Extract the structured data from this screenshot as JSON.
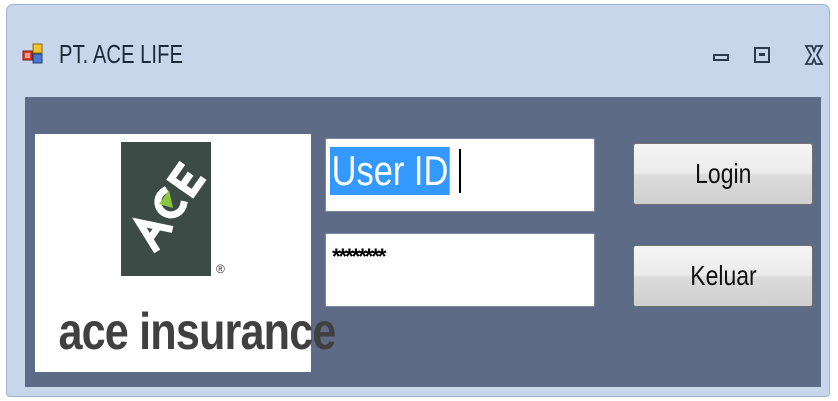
{
  "window": {
    "title": "PT. ACE LIFE",
    "controls": [
      "minimize-icon",
      "maximize-icon",
      "close-icon"
    ]
  },
  "logo": {
    "mark_text": "ACE",
    "registered": "®",
    "wordmark": "ace insurance"
  },
  "form": {
    "user_id_value": "User ID",
    "password_value": "********"
  },
  "buttons": {
    "login_label": "Login",
    "exit_label": "Keluar"
  },
  "colors": {
    "titlebar": "#c7d6ea",
    "client_bg": "#5d6b86",
    "selection": "#3399ff",
    "logo_box": "#3d4b47",
    "logo_accent": "#8cc63f"
  }
}
